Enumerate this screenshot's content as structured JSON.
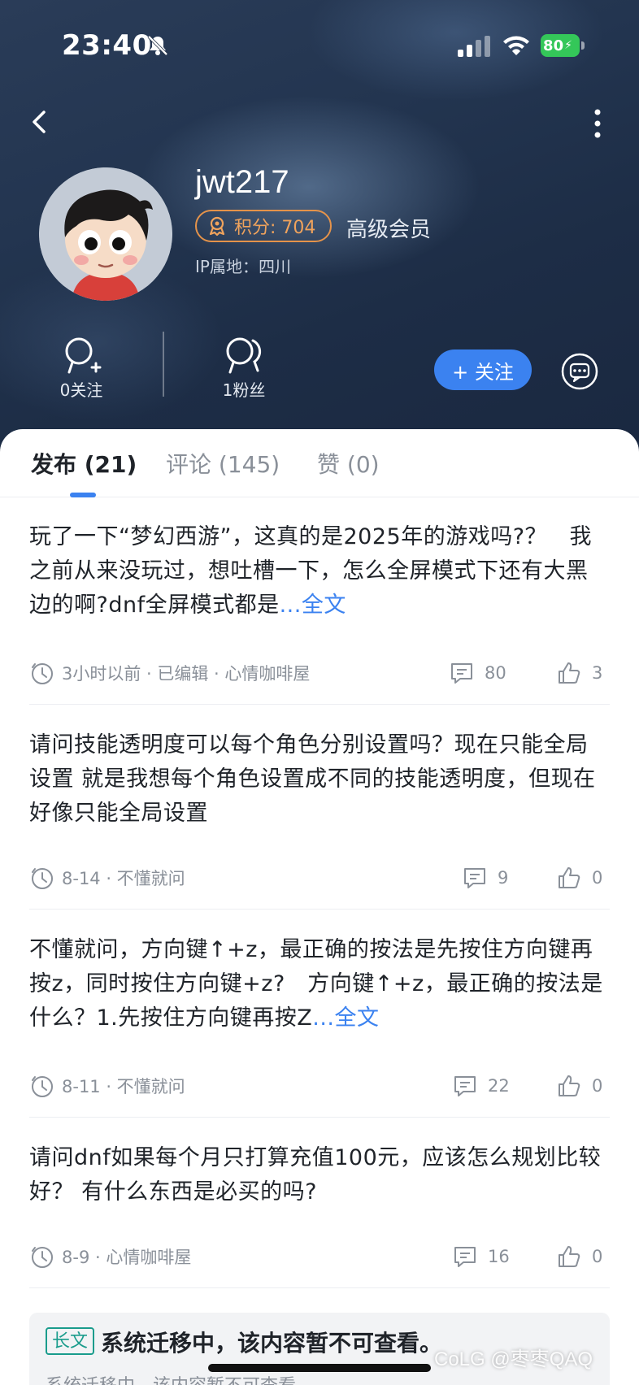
{
  "status_bar": {
    "time": "23:40",
    "battery": "80",
    "icons": [
      "bell-off-icon",
      "cellular-signal-icon",
      "wifi-icon",
      "battery-charging-icon"
    ]
  },
  "profile": {
    "username": "jwt217",
    "points_label": "积分: 704",
    "member_level": "高级会员",
    "ip_location": "IP属地：四川",
    "following_label": "0关注",
    "followers_label": "1粉丝",
    "follow_button": "+ 关注"
  },
  "tabs": [
    {
      "label": "发布 (21)",
      "active": true
    },
    {
      "label": "评论 (145)",
      "active": false
    },
    {
      "label": "赞 (0)",
      "active": false
    }
  ],
  "posts": [
    {
      "text": "玩了一下“梦幻西游”，这真的是2025年的游戏吗?？　我之前从来没玩过，想吐槽一下，怎么全屏模式下还有大黑边的啊?dnf全屏模式都是",
      "more": "...全文",
      "meta": "3小时以前 · 已编辑 · 心情咖啡屋",
      "comments": "80",
      "likes": "3"
    },
    {
      "text": "请问技能透明度可以每个角色分别设置吗？现在只能全局设置  就是我想每个角色设置成不同的技能透明度，但现在好像只能全局设置",
      "more": "",
      "meta": "8-14 · 不懂就问",
      "comments": "9",
      "likes": "0"
    },
    {
      "text": "不懂就问，方向键↑+z，最正确的按法是先按住方向键再按z，同时按住方向键+z?　方向键↑+z，最正确的按法是什么？1.先按住方向键再按Z",
      "more": "...全文",
      "meta": "8-11 · 不懂就问",
      "comments": "22",
      "likes": "0"
    },
    {
      "text": "请问dnf如果每个月只打算充值100元，应该怎么规划比较好？ 有什么东西是必买的吗?",
      "more": "",
      "meta": "8-9 · 心情咖啡屋",
      "comments": "16",
      "likes": "0"
    }
  ],
  "long_post": {
    "tag": "长文",
    "title": "系统迁移中，该内容暂不可查看。",
    "subtitle": "系统迁移中，该内容暂不可查看"
  },
  "watermark": "CoLG @枣枣QAQ",
  "colors": {
    "accent": "#3b82f0",
    "points": "#e5934a",
    "long_tag": "#1a9c8c",
    "battery": "#34c759"
  }
}
